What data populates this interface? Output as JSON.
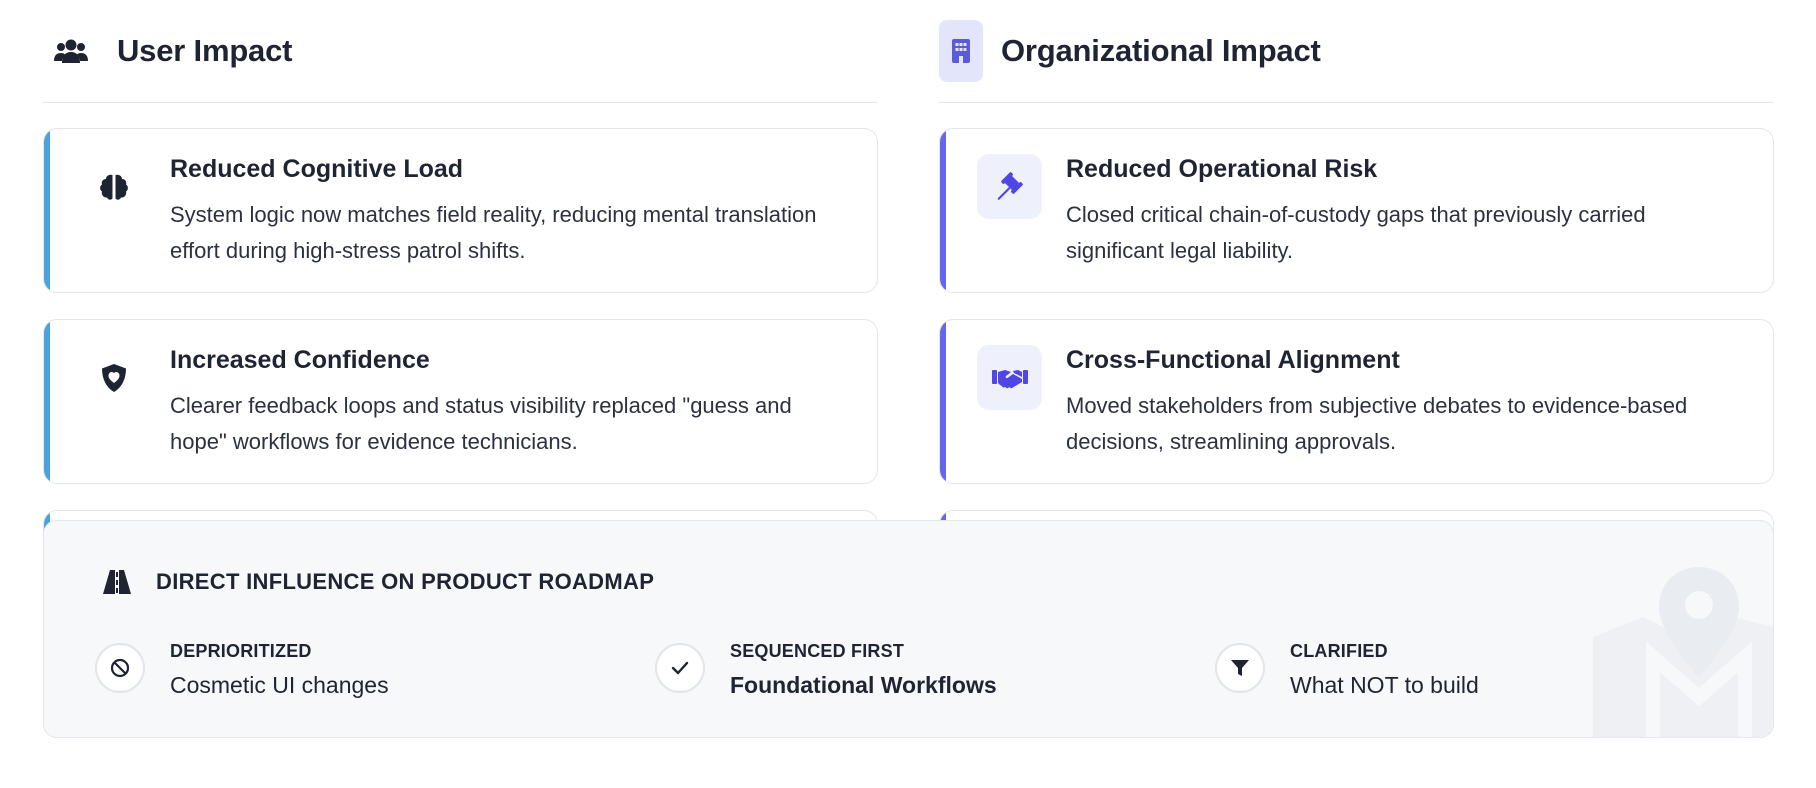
{
  "user_impact": {
    "title": "User Impact",
    "icon": "users-icon",
    "accent": "#4aa3dc",
    "cards": [
      {
        "icon": "brain-icon",
        "title": "Reduced Cognitive Load",
        "description": "System logic now matches field reality, reducing mental translation effort during high-stress patrol shifts."
      },
      {
        "icon": "shield-heart-icon",
        "title": "Increased Confidence",
        "description": "Clearer feedback loops and status visibility replaced \"guess and hope\" workflows for evidence technicians."
      }
    ]
  },
  "organizational_impact": {
    "title": "Organizational Impact",
    "icon": "building-icon",
    "accent": "#6366f1",
    "cards": [
      {
        "icon": "gavel-icon",
        "title": "Reduced Operational Risk",
        "description": "Closed critical chain-of-custody gaps that previously carried significant legal liability."
      },
      {
        "icon": "handshake-icon",
        "title": "Cross-Functional Alignment",
        "description": "Moved stakeholders from subjective debates to evidence-based decisions, streamlining approvals."
      }
    ]
  },
  "roadmap": {
    "icon": "road-icon",
    "title": "DIRECT INFLUENCE ON PRODUCT ROADMAP",
    "items": [
      {
        "icon": "ban-icon",
        "label": "DEPRIORITIZED",
        "value": "Cosmetic UI changes"
      },
      {
        "icon": "check-icon",
        "label": "SEQUENCED FIRST",
        "value": "Foundational Workflows"
      },
      {
        "icon": "filter-icon",
        "label": "CLARIFIED",
        "value": "What NOT to build"
      }
    ],
    "watermark_icon": "map-pin-icon"
  }
}
